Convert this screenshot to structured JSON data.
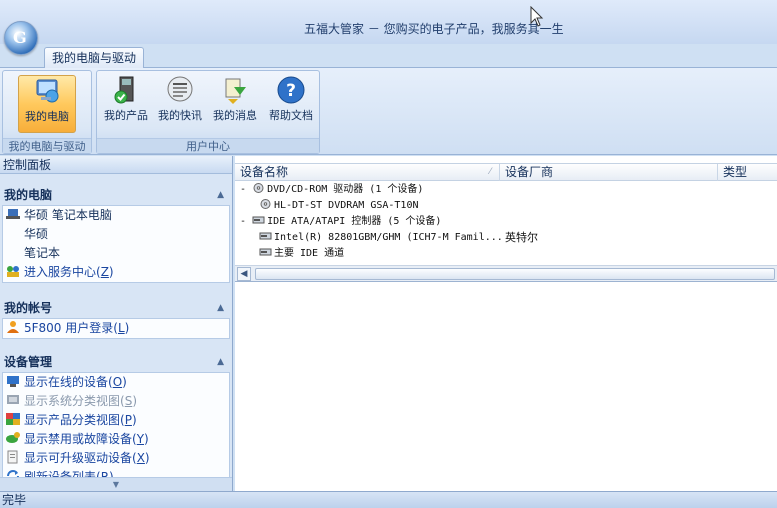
{
  "window": {
    "title": "五福大管家 － 您购买的电子产品，我服务其一生",
    "logo_letter": "G"
  },
  "ribbon": {
    "tab_label": "我的电脑与驱动",
    "groups": [
      {
        "label": "我的电脑与驱动",
        "buttons": [
          {
            "label": "我的电脑",
            "icon": "my-computer-icon"
          }
        ]
      },
      {
        "label": "用户中心",
        "buttons": [
          {
            "label": "我的产品",
            "icon": "products-icon"
          },
          {
            "label": "我的快讯",
            "icon": "newspaper-icon"
          },
          {
            "label": "我的消息",
            "icon": "message-icon"
          },
          {
            "label": "帮助文档",
            "icon": "help-icon"
          }
        ]
      }
    ]
  },
  "left_panel": {
    "header": "控制面板",
    "my_computer": {
      "title": "我的电脑",
      "items": [
        "华硕 笔记本电脑",
        "华硕",
        "笔记本"
      ],
      "service_link": {
        "text": "进入服务中心(",
        "key": "Z",
        "suffix": ")"
      }
    },
    "account": {
      "title": "我的帐号",
      "login_link": {
        "text": "5F800 用户登录(",
        "key": "L",
        "suffix": ")"
      }
    },
    "device_mgmt": {
      "title": "设备管理",
      "items": [
        {
          "text": "显示在线的设备(",
          "key": "O",
          "suffix": ")"
        },
        {
          "text": "显示系统分类视图(",
          "key": "S",
          "suffix": ")"
        },
        {
          "text": "显示产品分类视图(",
          "key": "P",
          "suffix": ")"
        },
        {
          "text": "显示禁用或故障设备(",
          "key": "Y",
          "suffix": ")"
        },
        {
          "text": "显示可升级驱动设备(",
          "key": "X",
          "suffix": ")"
        },
        {
          "text": "刷新设备列表(",
          "key": "R",
          "suffix": ")"
        }
      ]
    }
  },
  "device_table": {
    "columns": [
      "设备名称",
      "设备厂商",
      "类型"
    ],
    "rows": [
      {
        "name": "DVD/CD-ROM 驱动器 (1 个设备)",
        "vendor": "",
        "prefix": "-"
      },
      {
        "name": "HL-DT-ST DVDRAM GSA-T10N",
        "vendor": "",
        "prefix": ""
      },
      {
        "name": "IDE ATA/ATAPI 控制器 (5 个设备)",
        "vendor": "",
        "prefix": "-"
      },
      {
        "name": "Intel(R) 82801GBM/GHM (ICH7-M Famil...",
        "vendor": "英特尔",
        "prefix": ""
      },
      {
        "name": "主要 IDE 通道",
        "vendor": "",
        "prefix": ""
      }
    ]
  },
  "status_bar": {
    "text": "完毕"
  },
  "colors": {
    "accent": "#1a46a0",
    "active_button": "#ffc95d"
  }
}
